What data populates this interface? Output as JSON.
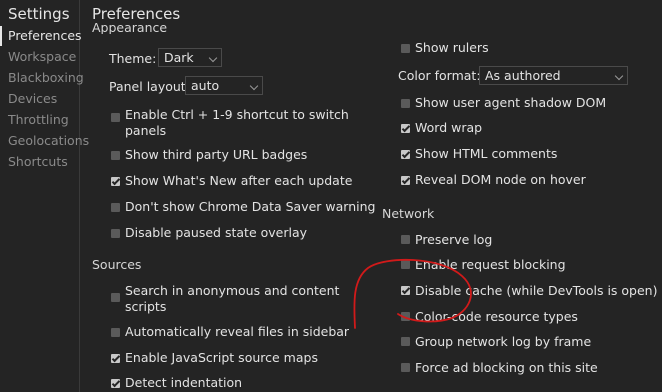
{
  "sidebar": {
    "title": "Settings",
    "items": [
      {
        "label": "Preferences"
      },
      {
        "label": "Workspace"
      },
      {
        "label": "Blackboxing"
      },
      {
        "label": "Devices"
      },
      {
        "label": "Throttling"
      },
      {
        "label": "Geolocations"
      },
      {
        "label": "Shortcuts"
      }
    ]
  },
  "pane": {
    "title": "Preferences",
    "appearance": {
      "heading": "Appearance",
      "theme_label": "Theme:",
      "theme_value": "Dark",
      "panel_layout_label": "Panel layout:",
      "panel_layout_value": "auto",
      "options": [
        {
          "label": "Enable Ctrl + 1-9 shortcut to switch",
          "label2": "panels",
          "checked": false
        },
        {
          "label": "Show third party URL badges",
          "checked": false
        },
        {
          "label": "Show What's New after each update",
          "checked": true
        },
        {
          "label": "Don't show Chrome Data Saver warning",
          "checked": false
        },
        {
          "label": "Disable paused state overlay",
          "checked": false
        }
      ]
    },
    "sources": {
      "heading": "Sources",
      "options": [
        {
          "label": "Search in anonymous and content",
          "label2": "scripts",
          "checked": false
        },
        {
          "label": "Automatically reveal files in sidebar",
          "checked": false
        },
        {
          "label": "Enable JavaScript source maps",
          "checked": true
        },
        {
          "label": "Detect indentation",
          "checked": true
        }
      ]
    },
    "elements": {
      "show_rulers": {
        "label": "Show rulers",
        "checked": false
      },
      "color_format_label": "Color format:",
      "color_format_value": "As authored",
      "options": [
        {
          "label": "Show user agent shadow DOM",
          "checked": false
        },
        {
          "label": "Word wrap",
          "checked": true
        },
        {
          "label": "Show HTML comments",
          "checked": true
        },
        {
          "label": "Reveal DOM node on hover",
          "checked": true
        }
      ]
    },
    "network": {
      "heading": "Network",
      "options": [
        {
          "label": "Preserve log",
          "checked": false
        },
        {
          "label": "Enable request blocking",
          "checked": false
        },
        {
          "label": "Disable cache (while DevTools is open)",
          "checked": true
        },
        {
          "label": "Color-code resource types",
          "checked": false
        },
        {
          "label": "Group network log by frame",
          "checked": false
        },
        {
          "label": "Force ad blocking on this site",
          "checked": false
        }
      ]
    }
  },
  "colors": {
    "background": "#242424",
    "annotation": "#d11a1a"
  }
}
